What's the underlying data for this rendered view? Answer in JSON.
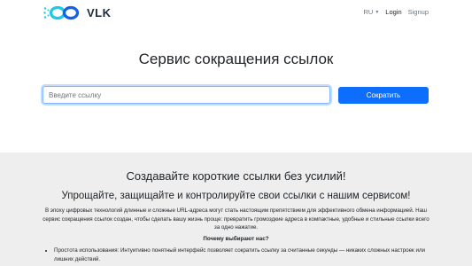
{
  "header": {
    "logo_text": "VLK",
    "lang": "RU",
    "login": "Login",
    "signup": "Signup"
  },
  "hero": {
    "title": "Сервис сокращения ссылок",
    "input_placeholder": "Введите ссылку",
    "button_label": "Сократить"
  },
  "info": {
    "heading": "Создавайте короткие ссылки без усилий!",
    "subheading": "Упрощайте, защищайте и контролируйте свои ссылки с нашим сервисом!",
    "description": "В эпоху цифровых технологий длинные и сложные URL-адреса могут стать настоящим препятствием для эффективного обмена информацией. Наш сервис сокращения ссылок создан, чтобы сделать вашу жизнь проще: превратить громоздкие адреса в компактные, удобные и стильные ссылки всего за одно нажатие.",
    "why_title": "Почему выбирают нас?",
    "features": [
      "Простота использования: Интуитивно понятный интерфейс позволяет сократить ссылку за считанные секунды — никаких сложных настроек или лишних действий."
    ]
  },
  "colors": {
    "primary": "#0d6efd",
    "info_bg": "#eeeeee",
    "logo_cyan": "#1ec8e6",
    "logo_blue": "#1560e8"
  }
}
